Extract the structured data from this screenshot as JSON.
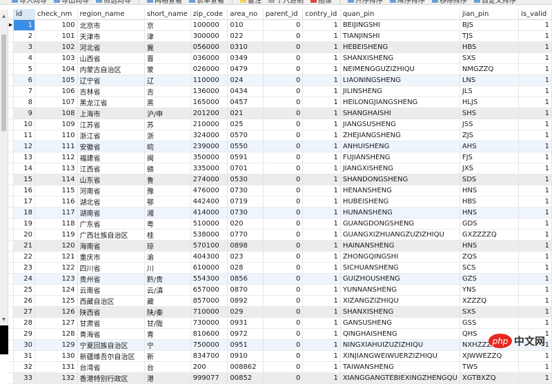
{
  "toolbar": {
    "items": [
      {
        "label": "导入向导",
        "icon": "import-icon"
      },
      {
        "label": "导出向导",
        "icon": "export-icon"
      },
      {
        "label": "筛选向导",
        "icon": "filter-icon"
      },
      {
        "label": "网格查看",
        "icon": "grid-view-icon"
      },
      {
        "label": "表单查看",
        "icon": "form-view-icon"
      },
      {
        "label": "备注",
        "icon": "note-icon"
      },
      {
        "label": "十六进制",
        "icon": "hex-icon"
      },
      {
        "label": "图像",
        "icon": "image-icon"
      },
      {
        "label": "升序排序",
        "icon": "sort-asc-icon"
      },
      {
        "label": "降序排序",
        "icon": "sort-desc-icon"
      },
      {
        "label": "移除排序",
        "icon": "remove-sort-icon"
      },
      {
        "label": "自定义排序",
        "icon": "custom-sort-icon"
      }
    ]
  },
  "columns": [
    "id",
    "check_nm",
    "region_name",
    "short_name",
    "zip_code",
    "area_no",
    "parent_id",
    "contry_id",
    "quan_pin",
    "jian_pin",
    "is_valid"
  ],
  "rows": [
    [
      "1",
      "100",
      "北京市",
      "京",
      "100000",
      "010",
      "0",
      "1",
      "BEIJINGSHI",
      "BJS",
      "1"
    ],
    [
      "2",
      "101",
      "天津市",
      "津",
      "300000",
      "022",
      "0",
      "1",
      "TIANJINSHI",
      "TJS",
      "1"
    ],
    [
      "3",
      "102",
      "河北省",
      "冀",
      "056000",
      "0310",
      "0",
      "1",
      "HEBEISHENG",
      "HBS",
      "1"
    ],
    [
      "4",
      "103",
      "山西省",
      "晋",
      "036000",
      "0349",
      "0",
      "1",
      "SHANXISHENG",
      "SXS",
      "1"
    ],
    [
      "5",
      "104",
      "内蒙古自治区",
      "蒙",
      "026000",
      "0479",
      "0",
      "1",
      "NEIMENGGUZIZHIQU",
      "NMGZZQ",
      "1"
    ],
    [
      "6",
      "105",
      "辽宁省",
      "辽",
      "110000",
      "024",
      "0",
      "1",
      "LIAONINGSHENG",
      "LNS",
      "1"
    ],
    [
      "7",
      "106",
      "吉林省",
      "吉",
      "136000",
      "0434",
      "0",
      "1",
      "JILINSHENG",
      "JLS",
      "1"
    ],
    [
      "8",
      "107",
      "黑龙江省",
      "黑",
      "165000",
      "0457",
      "0",
      "1",
      "HEILONGJIANGSHENG",
      "HLJS",
      "1"
    ],
    [
      "9",
      "108",
      "上海市",
      "沪/申",
      "201200",
      "021",
      "0",
      "1",
      "SHANGHAISHI",
      "SHS",
      "1"
    ],
    [
      "10",
      "109",
      "江苏省",
      "苏",
      "210000",
      "025",
      "0",
      "1",
      "JIANGSUSHENG",
      "JSS",
      "1"
    ],
    [
      "11",
      "110",
      "浙江省",
      "浙",
      "324000",
      "0570",
      "0",
      "1",
      "ZHEJIANGSHENG",
      "ZJS",
      "1"
    ],
    [
      "12",
      "111",
      "安徽省",
      "皖",
      "239000",
      "0550",
      "0",
      "1",
      "ANHUISHENG",
      "AHS",
      "1"
    ],
    [
      "13",
      "112",
      "福建省",
      "闽",
      "350000",
      "0591",
      "0",
      "1",
      "FUJIANSHENG",
      "FJS",
      "1"
    ],
    [
      "14",
      "113",
      "江西省",
      "赣",
      "335000",
      "0701",
      "0",
      "1",
      "JIANGXISHENG",
      "JXS",
      "1"
    ],
    [
      "15",
      "114",
      "山东省",
      "鲁",
      "274000",
      "0530",
      "0",
      "1",
      "SHANDONGSHENG",
      "SDS",
      "1"
    ],
    [
      "16",
      "115",
      "河南省",
      "豫",
      "476000",
      "0730",
      "0",
      "1",
      "HENANSHENG",
      "HNS",
      "1"
    ],
    [
      "17",
      "116",
      "湖北省",
      "鄂",
      "442400",
      "0719",
      "0",
      "1",
      "HUBEISHENG",
      "HBS",
      "1"
    ],
    [
      "18",
      "117",
      "湖南省",
      "湘",
      "414000",
      "0730",
      "0",
      "1",
      "HUNANSHENG",
      "HNS",
      "1"
    ],
    [
      "19",
      "118",
      "广东省",
      "粤",
      "510000",
      "020",
      "0",
      "1",
      "GUANGDONGSHENG",
      "GDS",
      "1"
    ],
    [
      "20",
      "119",
      "广西壮族自治区",
      "桂",
      "538000",
      "0770",
      "0",
      "1",
      "GUANGXIZHUANGZUZIZHIQU",
      "GXZZZZQ",
      "1"
    ],
    [
      "21",
      "120",
      "海南省",
      "琼",
      "570100",
      "0898",
      "0",
      "1",
      "HAINANSHENG",
      "HNS",
      "1"
    ],
    [
      "22",
      "121",
      "重庆市",
      "渝",
      "404300",
      "023",
      "0",
      "1",
      "ZHONGQINGSHI",
      "ZQS",
      "1"
    ],
    [
      "23",
      "122",
      "四川省",
      "川",
      "610000",
      "028",
      "0",
      "1",
      "SICHUANSHENG",
      "SCS",
      "1"
    ],
    [
      "24",
      "123",
      "贵州省",
      "黔/贵",
      "554300",
      "0856",
      "0",
      "1",
      "GUIZHOUSHENG",
      "GZS",
      "1"
    ],
    [
      "25",
      "124",
      "云南省",
      "云/滇",
      "657000",
      "0870",
      "0",
      "1",
      "YUNNANSHENG",
      "YNS",
      "1"
    ],
    [
      "26",
      "125",
      "西藏自治区",
      "藏",
      "857000",
      "0892",
      "0",
      "1",
      "XIZANGZIZHIQU",
      "XZZZQ",
      "1"
    ],
    [
      "27",
      "126",
      "陕西省",
      "陕/秦",
      "710000",
      "029",
      "0",
      "1",
      "SHANXISHENG",
      "SXS",
      "1"
    ],
    [
      "28",
      "127",
      "甘肃省",
      "甘/陇",
      "730000",
      "0931",
      "0",
      "1",
      "GANSUSHENG",
      "GSS",
      "1"
    ],
    [
      "29",
      "128",
      "青海省",
      "青",
      "810600",
      "0972",
      "0",
      "1",
      "QINGHAISHENG",
      "QHS",
      "1"
    ],
    [
      "30",
      "129",
      "宁夏回族自治区",
      "宁",
      "750000",
      "0951",
      "0",
      "1",
      "NINGXIAHUIZUZIZHIQU",
      "NXHZZZQ",
      "1"
    ],
    [
      "31",
      "130",
      "新疆维吾尔自治区",
      "新",
      "834700",
      "0910",
      "0",
      "1",
      "XINJIANGWEIWUERZIZHIQU",
      "XJWWEZZQ",
      "1"
    ],
    [
      "32",
      "131",
      "台湾省",
      "台",
      "200",
      "008862",
      "0",
      "1",
      "TAIWANSHENG",
      "TWS",
      "1"
    ],
    [
      "33",
      "132",
      "香港特别行政区",
      "港",
      "999077",
      "00852",
      "0",
      "1",
      "XIANGGANGTEBIEXINGZHENGQU",
      "XGTBXZQ",
      "1"
    ]
  ],
  "watermark": {
    "php": "php",
    "cn": "中文网"
  }
}
